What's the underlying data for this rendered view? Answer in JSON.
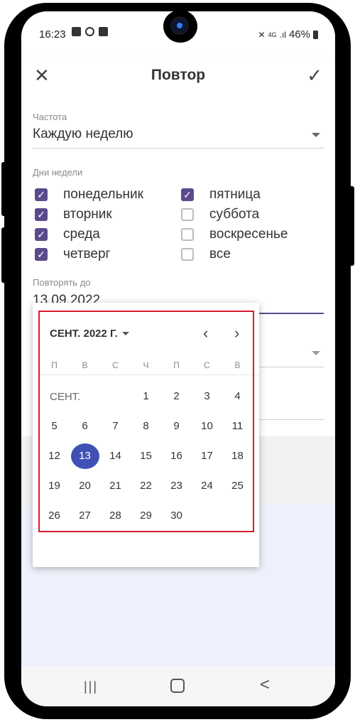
{
  "status_bar": {
    "time": "16:23",
    "network": "4G",
    "battery": "46%"
  },
  "toolbar": {
    "title": "Повтор",
    "close_label": "✕",
    "confirm_label": "✓"
  },
  "form": {
    "frequency": {
      "label": "Частота",
      "value": "Каждую неделю"
    },
    "weekdays_label": "Дни недели",
    "weekdays": [
      {
        "label": "понедельник",
        "checked": true
      },
      {
        "label": "вторник",
        "checked": true
      },
      {
        "label": "среда",
        "checked": true
      },
      {
        "label": "четверг",
        "checked": true
      },
      {
        "label": "пятница",
        "checked": true
      },
      {
        "label": "суббота",
        "checked": false
      },
      {
        "label": "воскресенье",
        "checked": false
      },
      {
        "label": "все",
        "checked": false
      }
    ],
    "repeat_until": {
      "label": "Повторять до",
      "value": "13.09.2022"
    }
  },
  "date_picker": {
    "header": "СЕНТ. 2022 Г.",
    "month_label": "СЕНТ.",
    "weekdays": [
      "П",
      "В",
      "С",
      "Ч",
      "П",
      "С",
      "В"
    ],
    "selected_day": 13,
    "rows": [
      [
        null,
        null,
        null,
        1,
        2,
        3,
        4
      ],
      [
        5,
        6,
        7,
        8,
        9,
        10,
        11
      ],
      [
        12,
        13,
        14,
        15,
        16,
        17,
        18
      ],
      [
        19,
        20,
        21,
        22,
        23,
        24,
        25
      ],
      [
        26,
        27,
        28,
        29,
        30,
        null,
        null
      ]
    ],
    "highlight_color": "#d81b2c",
    "selected_color": "#3f51b5"
  },
  "colors": {
    "checkbox_checked": "#5b4a8b",
    "accent_underline": "#5b4a8b"
  },
  "navbar": {
    "recent_icon": "recent-apps-icon",
    "home_icon": "home-icon",
    "back_icon": "back-icon"
  }
}
